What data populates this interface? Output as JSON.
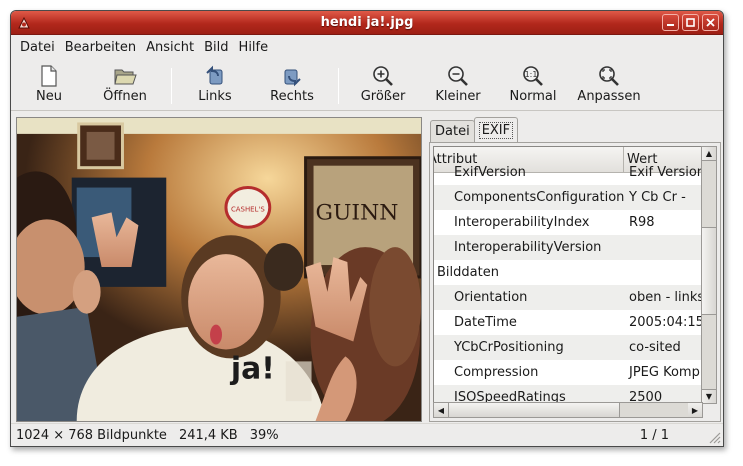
{
  "window": {
    "title": "hendi ja!.jpg",
    "accent": "#b2281c"
  },
  "menu": [
    {
      "label": "Datei"
    },
    {
      "label": "Bearbeiten"
    },
    {
      "label": "Ansicht"
    },
    {
      "label": "Bild"
    },
    {
      "label": "Hilfe"
    }
  ],
  "toolbar": {
    "new": "Neu",
    "open": "Öffnen",
    "left": "Links",
    "right": "Rechts",
    "bigger": "Größer",
    "smaller": "Kleiner",
    "normal": "Normal",
    "fit": "Anpassen"
  },
  "tabs": {
    "file": "Datei",
    "exif": "EXIF"
  },
  "table": {
    "headers": {
      "attribute": "Attribut",
      "value": "Wert"
    },
    "rows": [
      {
        "attr": "ExifVersion",
        "val": "Exif Version"
      },
      {
        "attr": "ComponentsConfiguration",
        "val": "Y Cb Cr -"
      },
      {
        "attr": "InteroperabilityIndex",
        "val": "R98"
      },
      {
        "attr": "InteroperabilityVersion",
        "val": ""
      },
      {
        "attr": "Bilddaten",
        "val": ""
      },
      {
        "attr": "Orientation",
        "val": "oben - links"
      },
      {
        "attr": "DateTime",
        "val": "2005:04:15"
      },
      {
        "attr": "YCbCrPositioning",
        "val": "co-sited"
      },
      {
        "attr": "Compression",
        "val": "JPEG Kompr"
      },
      {
        "attr": "ISOSpeedRatings",
        "val": "2500"
      }
    ]
  },
  "status": {
    "dimensions": "1024 × 768 Bildpunkte",
    "size": "241,4 KB",
    "zoom": "39%",
    "pages": "1 / 1"
  },
  "photo": {
    "shirt_text": "ja!",
    "sign_text": "CASHEL'S",
    "mirror_text": "GUINN"
  }
}
